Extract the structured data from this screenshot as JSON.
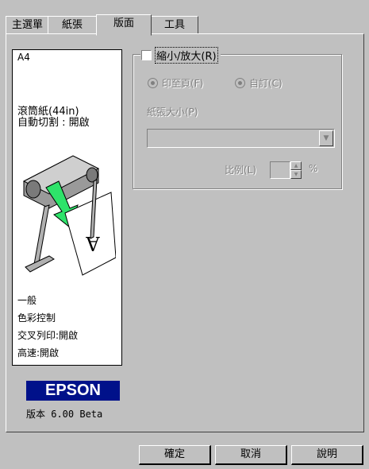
{
  "tabs": [
    {
      "label": "主選單"
    },
    {
      "label": "紙張"
    },
    {
      "label": "版面"
    },
    {
      "label": "工具"
    }
  ],
  "preview": {
    "paper_size": "A4",
    "roll_paper": "滾筒紙(44in)",
    "auto_cut": "自動切割 : 開啟",
    "settings": [
      "一般",
      "色彩控制",
      "交叉列印:開啟",
      "高速:開啟"
    ],
    "brand": "EPSON",
    "version": "版本 6.00 Beta"
  },
  "reduce_enlarge": {
    "checkbox_label": "縮小/放大(R)",
    "checked": false,
    "option_fit_page": "印至頁(F)",
    "option_custom": "自訂(C)",
    "paper_size_label": "紙張大小(P)",
    "paper_size_value": "",
    "scale_label": "比例(L)",
    "scale_value": "",
    "scale_unit": "%"
  },
  "buttons": {
    "ok": "確定",
    "cancel": "取消",
    "help": "說明"
  },
  "colors": {
    "dialog_bg": "#c0c0c0",
    "brand_bg": "#00118a",
    "arrow_green": "#2ee36a"
  }
}
